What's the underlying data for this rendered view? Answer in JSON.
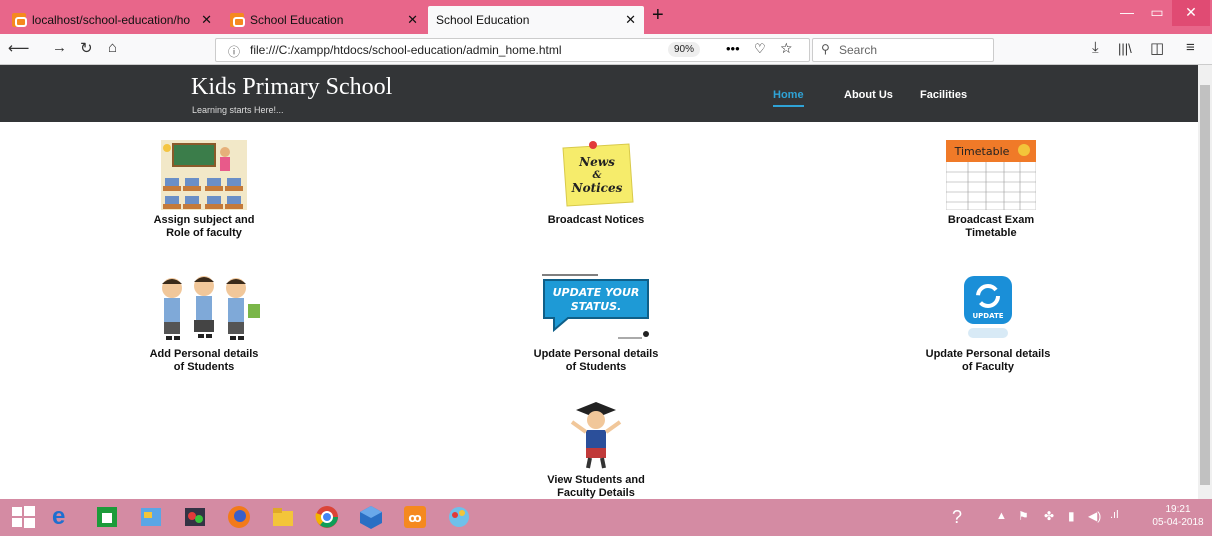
{
  "browser": {
    "tabs": [
      {
        "label": "localhost/school-education/ho"
      },
      {
        "label": "School Education"
      },
      {
        "label": "School Education"
      }
    ],
    "url": "file:///C:/xampp/htdocs/school-education/admin_home.html",
    "zoom": "90%",
    "search_placeholder": "Search"
  },
  "site": {
    "brand": "Kids Primary School",
    "tagline": "Learning starts Here!...",
    "nav": [
      {
        "label": "Home"
      },
      {
        "label": "About Us"
      },
      {
        "label": "Facilities"
      }
    ],
    "accent": "#2fa3d6"
  },
  "cards": [
    {
      "line1": "Assign subject and",
      "line2": "Role of faculty",
      "icon": "classroom-icon"
    },
    {
      "line1": "Broadcast Notices",
      "line2": "",
      "icon": "news-notices-icon",
      "img_text1": "News",
      "img_text2": "&",
      "img_text3": "Notices"
    },
    {
      "line1": "Broadcast Exam",
      "line2": "Timetable",
      "icon": "timetable-icon",
      "img_text": "Timetable"
    },
    {
      "line1": "Add Personal details",
      "line2": "of Students",
      "icon": "students-icon"
    },
    {
      "line1": "Update Personal details",
      "line2": "of Students",
      "icon": "update-status-icon",
      "img_text": "UPDATE YOUR STATUS."
    },
    {
      "line1": "Update Personal details",
      "line2": "of Faculty",
      "icon": "update-app-icon",
      "img_text": "UPDATE"
    },
    {
      "line1": "View Students and",
      "line2": "Faculty Details",
      "icon": "graduate-icon"
    }
  ],
  "taskbar": {
    "time": "19:21",
    "date": "05-04-2018"
  }
}
